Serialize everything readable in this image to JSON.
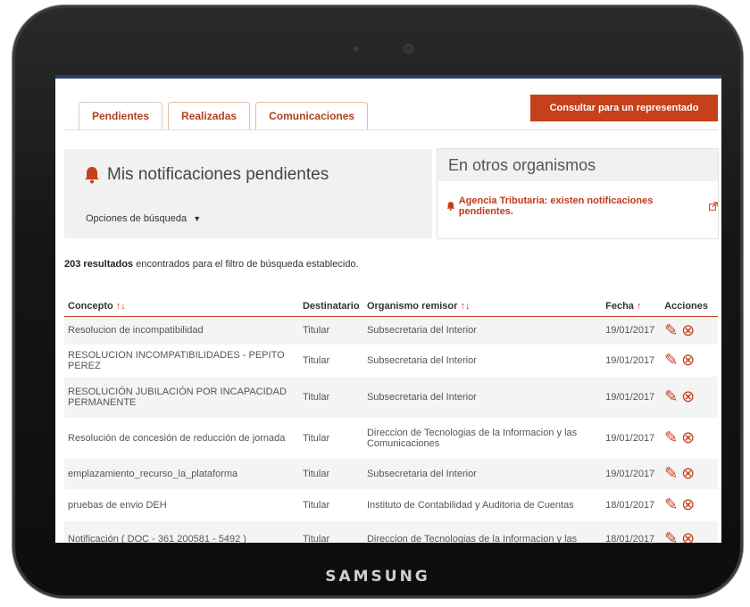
{
  "device": {
    "brand": "SAMSUNG"
  },
  "tabs": [
    {
      "label": "Pendientes"
    },
    {
      "label": "Realizadas"
    },
    {
      "label": "Comunicaciones"
    }
  ],
  "represent_button": "Consultar para un representado",
  "pending": {
    "title": "Mis notificaciones pendientes",
    "options": "Opciones de búsqueda"
  },
  "other": {
    "title": "En otros organismos",
    "link": "Agencia Tributaria: existen notificaciones pendientes."
  },
  "results": {
    "count": "203 resultados",
    "text": " encontrados para el filtro de búsqueda establecido."
  },
  "table": {
    "headers": {
      "concepto": "Concepto",
      "destinatario": "Destinatario",
      "organismo": "Organismo remisor",
      "fecha": "Fecha",
      "acciones": "Acciones"
    },
    "rows": [
      {
        "concepto": "Resolucion de incompatibilidad",
        "destinatario": "Titular",
        "organismo": "Subsecretaria del Interior",
        "fecha": "19/01/2017"
      },
      {
        "concepto": "RESOLUCION INCOMPATIBILIDADES - PEPITO PEREZ",
        "destinatario": "Titular",
        "organismo": "Subsecretaria del Interior",
        "fecha": "19/01/2017"
      },
      {
        "concepto": "RESOLUCIÓN JUBILACIÓN POR INCAPACIDAD PERMANENTE",
        "destinatario": "Titular",
        "organismo": "Subsecretaria del Interior",
        "fecha": "19/01/2017"
      },
      {
        "concepto": "Resolución de concesión de reducción de jornada",
        "destinatario": "Titular",
        "organismo": "Direccion de Tecnologias de la Informacion y las Comunicaciones",
        "fecha": "19/01/2017"
      },
      {
        "concepto": "emplazamiento_recurso_la_plataforma",
        "destinatario": "Titular",
        "organismo": "Subsecretaria del Interior",
        "fecha": "19/01/2017"
      },
      {
        "concepto": "pruebas de envio DEH",
        "destinatario": "Titular",
        "organismo": "Instituto de Contabilidad y Auditoria de Cuentas",
        "fecha": "18/01/2017"
      },
      {
        "concepto": "Notificación ( DOC - 361 200581 - 5492 )",
        "destinatario": "Titular",
        "organismo": "Direccion de Tecnologias de la Informacion y las",
        "fecha": "18/01/2017"
      }
    ]
  }
}
